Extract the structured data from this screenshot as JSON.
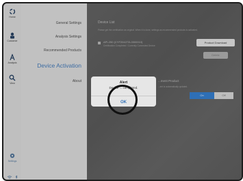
{
  "rail": {
    "items": [
      {
        "label": "Home",
        "icon": "home-icon"
      },
      {
        "label": "Customer",
        "icon": "person-icon"
      },
      {
        "label": "Analysis",
        "icon": "analysis-icon"
      },
      {
        "label": "View",
        "icon": "search-icon"
      }
    ],
    "settings_label": "Settings"
  },
  "menu": {
    "items": [
      "General Settings",
      "Analysis Settings",
      "Recommended Products"
    ],
    "active": "Device Activation",
    "about": "About"
  },
  "content": {
    "device_list_title": "Device List",
    "device_list_desc": "Please get the certification as original. When it is done, settings as recommended products is activated.",
    "device_name": "API-250 (CYF204272L0000010)",
    "device_status": "Certification Completed / Currently Connected Device",
    "product_download": "Product Download",
    "delete": "Delete",
    "section2_title": "...ment Product",
    "section2_desc": "...ent is automatically updated.",
    "toggle_on": "On",
    "toggle_off": "Off"
  },
  "alert": {
    "title": "Alert",
    "message": "Device ... completed.",
    "ok_label": "OK"
  },
  "colors": {
    "accent": "#3c74b4",
    "ok_blue": "#2f6fb6",
    "toggle_on": "#2e6fb6"
  }
}
